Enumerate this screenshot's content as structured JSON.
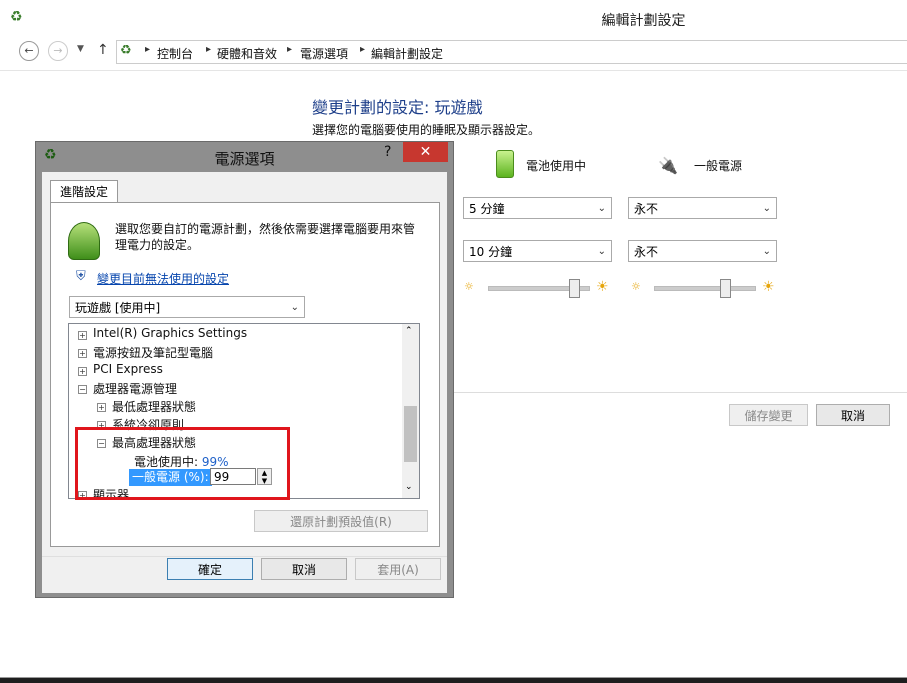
{
  "main_window": {
    "title": "編輯計劃設定",
    "breadcrumb": [
      "控制台",
      "硬體和音效",
      "電源選項",
      "編輯計劃設定"
    ],
    "heading": "變更計劃的設定: 玩遊戲",
    "description": "選擇您的電腦要使用的睡眠及顯示器設定。",
    "battery_header": "電池使用中",
    "plugged_header": "一般電源",
    "rows": [
      {
        "battery": "5 分鐘",
        "plugged": "永不"
      },
      {
        "battery": "10 分鐘",
        "plugged": "永不"
      }
    ],
    "brightness": {
      "battery_level": 0.85,
      "plugged_level": 0.7
    },
    "save_label": "儲存變更",
    "cancel_label": "取消"
  },
  "dialog": {
    "title": "電源選項",
    "help": "?",
    "close": "✕",
    "tab": "進階設定",
    "intro": "選取您要自訂的電源計劃，然後依需要選擇電腦要用來管理電力的設定。",
    "change_link": "變更目前無法使用的設定",
    "plan_select": "玩遊戲 [使用中]",
    "tree": [
      {
        "label": "Intel(R) Graphics Settings",
        "level": 0,
        "toggle": "+"
      },
      {
        "label": "電源按鈕及筆記型電腦",
        "level": 0,
        "toggle": "+"
      },
      {
        "label": "PCI Express",
        "level": 0,
        "toggle": "+"
      },
      {
        "label": "處理器電源管理",
        "level": 0,
        "toggle": "−"
      },
      {
        "label": "最低處理器狀態",
        "level": 1,
        "toggle": "+"
      },
      {
        "label": "系統冷卻原則",
        "level": 1,
        "toggle": "+"
      },
      {
        "label": "最高處理器狀態",
        "level": 1,
        "toggle": "−"
      }
    ],
    "battery_setting_label": "電池使用中:",
    "battery_setting_value": "99%",
    "plugged_setting_label": "一般電源 (%):",
    "plugged_setting_value": "99",
    "last_item": "顯示器",
    "restore_label": "還原計劃預設值(R)",
    "ok_label": "確定",
    "cancel_label": "取消",
    "apply_label": "套用(A)"
  },
  "colors": {
    "accent": "#1e3f8a",
    "highlight": "#3399ff",
    "close": "#c7372f",
    "annotation": "#e0161c"
  }
}
